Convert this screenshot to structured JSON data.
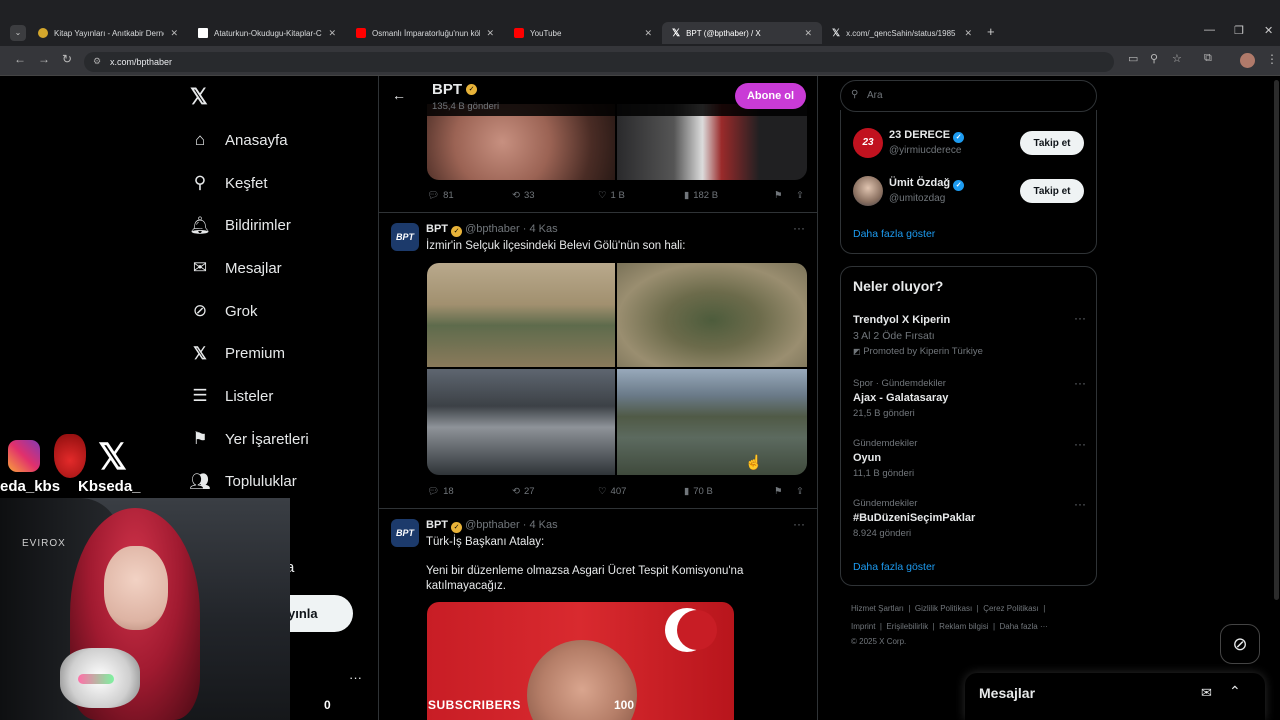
{
  "browser": {
    "tabs": [
      {
        "title": "Kitap Yayınları - Anıtkabir Derne",
        "favicon": "#d4a72c"
      },
      {
        "title": "Ataturkun-Okudugu-Kitaplar-C",
        "favicon": "#ffffff"
      },
      {
        "title": "Osmanlı İmparatorluğu'nun kök",
        "favicon": "#ff0000"
      },
      {
        "title": "YouTube",
        "favicon": "#ff0000"
      },
      {
        "title": "BPT (@bpthaber) / X",
        "favicon": "#000000"
      },
      {
        "title": "x.com/_qencSahin/status/1985",
        "favicon": "#000000"
      }
    ],
    "url": "x.com/bpthaber"
  },
  "nav": {
    "items": [
      {
        "label": "Anasayfa",
        "icon": "home-icon"
      },
      {
        "label": "Keşfet",
        "icon": "search-icon"
      },
      {
        "label": "Bildirimler",
        "icon": "bell-icon"
      },
      {
        "label": "Mesajlar",
        "icon": "mail-icon"
      },
      {
        "label": "Grok",
        "icon": "grok-icon"
      },
      {
        "label": "Premium",
        "icon": "x-logo-icon"
      },
      {
        "label": "Listeler",
        "icon": "list-icon"
      },
      {
        "label": "Yer İşaretleri",
        "icon": "bookmark-icon"
      },
      {
        "label": "Topluluklar",
        "icon": "communities-icon"
      }
    ],
    "hidden_item_fragment": "a",
    "post_button_fragment": "yınla",
    "more_dots": "···"
  },
  "profile": {
    "name": "BPT",
    "posts_count": "135,4 B gönderi",
    "subscribe_label": "Abone ol"
  },
  "tweets": [
    {
      "replies": "81",
      "retweets": "33",
      "likes": "1 B",
      "views": "182 B"
    },
    {
      "author": "BPT",
      "handle": "@bpthaber",
      "date": "4 Kas",
      "text": "İzmir'in Selçuk ilçesindeki Belevi Gölü'nün son hali:",
      "replies": "18",
      "retweets": "27",
      "likes": "407",
      "views": "70 B"
    },
    {
      "author": "BPT",
      "handle": "@bpthaber",
      "date": "4 Kas",
      "text": "Türk-İş Başkanı Atalay:",
      "text2": "Yeni bir düzenleme olmazsa Asgari Ücret Tespit Komisyonu'na katılmayacağız."
    }
  ],
  "right": {
    "search_placeholder": "Ara",
    "who_to_follow": [
      {
        "name": "23 DERECE",
        "handle": "@yirmiucderece",
        "button": "Takip et"
      },
      {
        "name": "Ümit Özdağ",
        "handle": "@umitozdag",
        "button": "Takip et"
      }
    ],
    "show_more": "Daha fazla göster",
    "trends_title": "Neler oluyor?",
    "trends": [
      {
        "category": "",
        "name": "Trendyol X Kiperin",
        "sub": "3 Al 2 Öde Fırsatı",
        "count": "Promoted by Kiperin Türkiye"
      },
      {
        "category": "Spor · Gündemdekiler",
        "name": "Ajax - Galatasaray",
        "sub": "",
        "count": "21,5 B gönderi"
      },
      {
        "category": "Gündemdekiler",
        "name": "Oyun",
        "sub": "",
        "count": "11,1 B gönderi"
      },
      {
        "category": "Gündemdekiler",
        "name": "#BuDüzeniSeçimPaklar",
        "sub": "",
        "count": "8.924 gönderi"
      }
    ],
    "trends_more": "Daha fazla göster",
    "footer": {
      "links1": [
        "Hizmet Şartları",
        "Gizlilik Politikası",
        "Çerez Politikası"
      ],
      "links2": [
        "Imprint",
        "Erişilebilirlik",
        "Reklam bilgisi",
        "Daha fazla ···"
      ],
      "copyright": "© 2025 X Corp."
    }
  },
  "messages_bar": {
    "label": "Mesajlar"
  },
  "overlay": {
    "instagram_handle": "eda_kbs",
    "kick_handle": "Kbseda_",
    "chair_brand": "EVIROX",
    "subscribers_label": "SUBSCRIBERS",
    "subscribers_value": "100",
    "counter_zero": "0"
  }
}
